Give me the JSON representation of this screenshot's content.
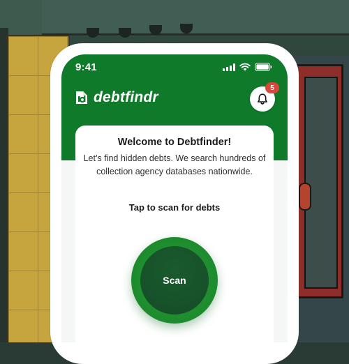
{
  "status_bar": {
    "time": "9:41"
  },
  "app": {
    "logo_text": "debtfindr",
    "notifications": {
      "count": "5"
    }
  },
  "card": {
    "title": "Welcome to Debtfinder!",
    "subtitle": "Let’s find hidden debts. We search hundreds of collection agency databases nationwide.",
    "scan_prompt": "Tap to scan for debts",
    "scan_button_label": "Scan"
  },
  "colors": {
    "header_green": "#0e7a2a",
    "scan_ring": "#1f8e2f",
    "scan_center": "#17522a",
    "badge": "#d9463b"
  },
  "icons": {
    "logo": "debtfindr-logo-icon",
    "bell": "bell-icon",
    "signal": "cellular-signal-icon",
    "wifi": "wifi-icon",
    "battery": "battery-icon"
  }
}
